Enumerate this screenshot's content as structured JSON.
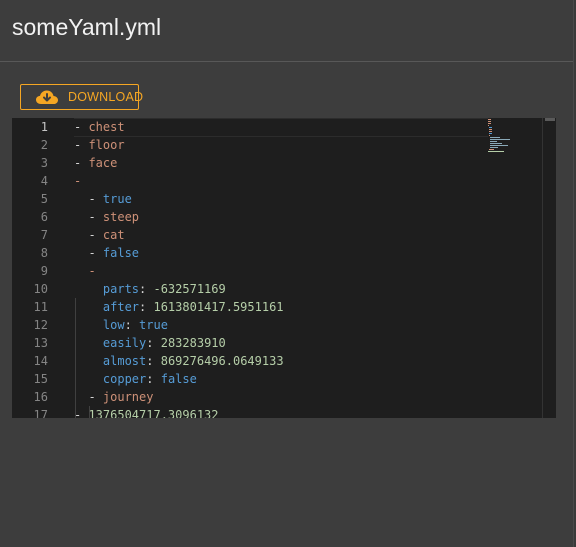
{
  "header": {
    "title": "someYaml.yml"
  },
  "toolbar": {
    "download_label": "DOWNLOAD"
  },
  "accent_color": "#f5a623",
  "editor": {
    "active_line": 1,
    "lines": [
      {
        "n": "1",
        "dash": "- ",
        "key": "",
        "sep": "",
        "val": "chest",
        "vt": "str"
      },
      {
        "n": "2",
        "dash": "- ",
        "key": "",
        "sep": "",
        "val": "floor",
        "vt": "str"
      },
      {
        "n": "3",
        "dash": "- ",
        "key": "",
        "sep": "",
        "val": "face",
        "vt": "str"
      },
      {
        "n": "4",
        "dash": "-",
        "key": "",
        "sep": "",
        "val": "",
        "vt": "str"
      },
      {
        "n": "5",
        "dash": "  - ",
        "key": "",
        "sep": "",
        "val": "true",
        "vt": "kw"
      },
      {
        "n": "6",
        "dash": "  - ",
        "key": "",
        "sep": "",
        "val": "steep",
        "vt": "str"
      },
      {
        "n": "7",
        "dash": "  - ",
        "key": "",
        "sep": "",
        "val": "cat",
        "vt": "str"
      },
      {
        "n": "8",
        "dash": "  - ",
        "key": "",
        "sep": "",
        "val": "false",
        "vt": "kw"
      },
      {
        "n": "9",
        "dash": "  -",
        "key": "",
        "sep": "",
        "val": "",
        "vt": "str"
      },
      {
        "n": "10",
        "dash": "    ",
        "key": "parts",
        "sep": ": ",
        "val": "-632571169",
        "vt": "num"
      },
      {
        "n": "11",
        "dash": "    ",
        "key": "after",
        "sep": ": ",
        "val": "1613801417.5951161",
        "vt": "num"
      },
      {
        "n": "12",
        "dash": "    ",
        "key": "low",
        "sep": ": ",
        "val": "true",
        "vt": "kw"
      },
      {
        "n": "13",
        "dash": "    ",
        "key": "easily",
        "sep": ": ",
        "val": "283283910",
        "vt": "num"
      },
      {
        "n": "14",
        "dash": "    ",
        "key": "almost",
        "sep": ": ",
        "val": "869276496.0649133",
        "vt": "num"
      },
      {
        "n": "15",
        "dash": "    ",
        "key": "copper",
        "sep": ": ",
        "val": "false",
        "vt": "kw"
      },
      {
        "n": "16",
        "dash": "  - ",
        "key": "",
        "sep": "",
        "val": "journey",
        "vt": "str"
      },
      {
        "n": "17",
        "dash": "- ",
        "key": "",
        "sep": "",
        "val": "1376504717.3096132",
        "vt": "num"
      }
    ]
  }
}
